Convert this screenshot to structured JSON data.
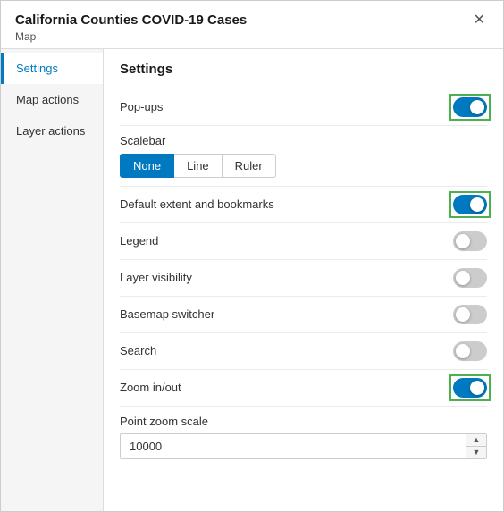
{
  "header": {
    "title": "California Counties COVID-19 Cases",
    "subtitle": "Map",
    "close_label": "✕"
  },
  "sidebar": {
    "items": [
      {
        "id": "settings",
        "label": "Settings",
        "active": true
      },
      {
        "id": "map-actions",
        "label": "Map actions",
        "active": false
      },
      {
        "id": "layer-actions",
        "label": "Layer actions",
        "active": false
      }
    ]
  },
  "main": {
    "section_title": "Settings",
    "settings": [
      {
        "id": "popups",
        "label": "Pop-ups",
        "type": "toggle",
        "value": true,
        "highlighted": true
      },
      {
        "id": "scalebar",
        "label": "Scalebar",
        "type": "scalebar",
        "options": [
          "None",
          "Line",
          "Ruler"
        ],
        "selected": "None"
      },
      {
        "id": "default-extent",
        "label": "Default extent and bookmarks",
        "type": "toggle",
        "value": true,
        "highlighted": true
      },
      {
        "id": "legend",
        "label": "Legend",
        "type": "toggle",
        "value": false,
        "highlighted": false
      },
      {
        "id": "layer-visibility",
        "label": "Layer visibility",
        "type": "toggle",
        "value": false,
        "highlighted": false
      },
      {
        "id": "basemap-switcher",
        "label": "Basemap switcher",
        "type": "toggle",
        "value": false,
        "highlighted": false
      },
      {
        "id": "search",
        "label": "Search",
        "type": "toggle",
        "value": false,
        "highlighted": false
      },
      {
        "id": "zoom-inout",
        "label": "Zoom in/out",
        "type": "toggle",
        "value": true,
        "highlighted": true
      }
    ],
    "point_zoom": {
      "label": "Point zoom scale",
      "value": "10000"
    }
  }
}
